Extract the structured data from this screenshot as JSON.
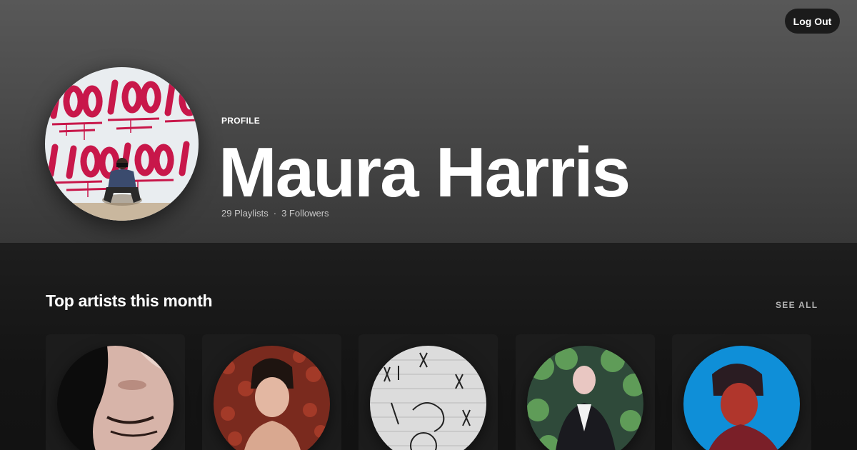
{
  "header": {
    "logout_label": "Log Out"
  },
  "profile": {
    "label": "PROFILE",
    "name": "Maura Harris",
    "playlists": "29 Playlists",
    "separator": "·",
    "followers": "3 Followers"
  },
  "top_artists": {
    "title": "Top artists this month",
    "see_all_label": "SEE ALL",
    "artists": [
      {
        "image": "artist-portrait-1"
      },
      {
        "image": "artist-portrait-2"
      },
      {
        "image": "artist-portrait-3"
      },
      {
        "image": "artist-portrait-4"
      },
      {
        "image": "artist-portrait-5"
      }
    ]
  },
  "colors": {
    "background": "#121212",
    "hero_top": "#585858",
    "hero_bottom": "#383838",
    "button_bg": "#1b1b1b",
    "card_bg": "#1c1c1c",
    "muted_text": "#b3b3b3"
  }
}
